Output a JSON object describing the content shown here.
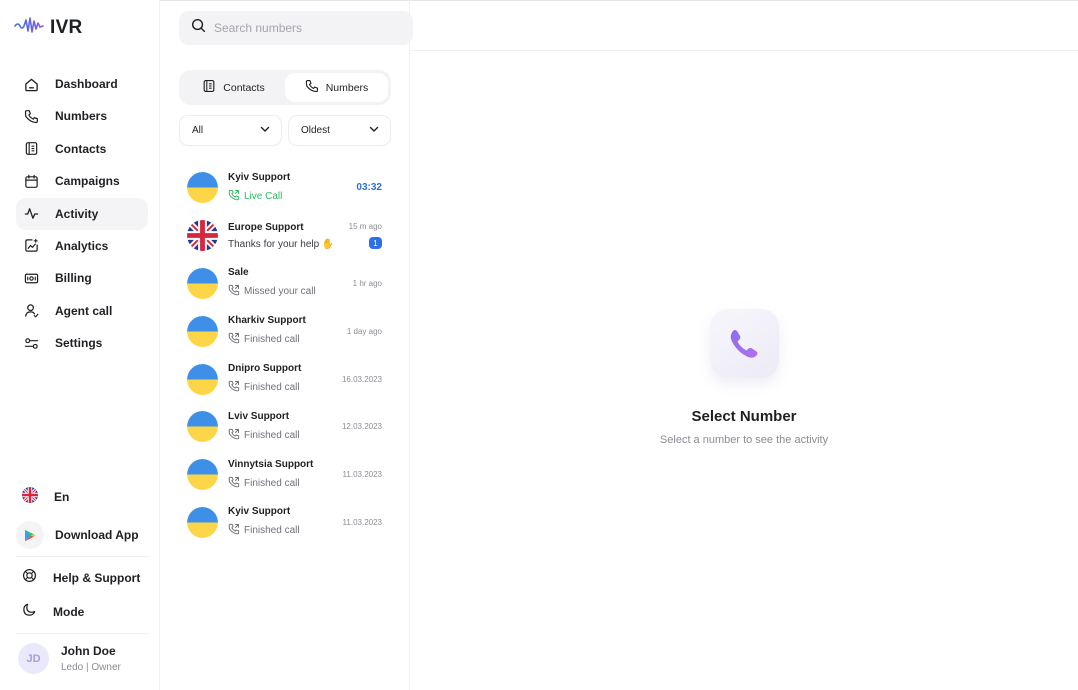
{
  "app": {
    "title": "IVR"
  },
  "colors": {
    "accent": "#2f6fe6",
    "live": "#2dbb5d",
    "brand": "#6c5ce7"
  },
  "search": {
    "placeholder": "Search numbers"
  },
  "sidebar": {
    "items": [
      {
        "label": "Dashboard",
        "icon": "home-icon"
      },
      {
        "label": "Numbers",
        "icon": "phone-icon"
      },
      {
        "label": "Contacts",
        "icon": "contacts-book-icon"
      },
      {
        "label": "Campaigns",
        "icon": "calendar-icon"
      },
      {
        "label": "Activity",
        "icon": "activity-pulse-icon",
        "active": true
      },
      {
        "label": "Analytics",
        "icon": "analytics-icon"
      },
      {
        "label": "Billing",
        "icon": "billing-icon"
      },
      {
        "label": "Agent call",
        "icon": "agent-icon"
      },
      {
        "label": "Settings",
        "icon": "settings-sliders-icon"
      }
    ],
    "language": "En",
    "download": "Download App",
    "help": "Help & Support",
    "mode": "Mode",
    "user": {
      "initials": "JD",
      "name": "John Doe",
      "role": "Ledo | Owner"
    }
  },
  "tabs": [
    {
      "label": "Contacts",
      "icon": "contacts-book-icon"
    },
    {
      "label": "Numbers",
      "icon": "phone-icon",
      "active": true
    }
  ],
  "filters": {
    "type": "All",
    "sort": "Oldest"
  },
  "calls": [
    {
      "name": "Kyiv Support",
      "status": "Live Call",
      "time": "03:32",
      "flag": "ua",
      "live": true
    },
    {
      "name": "Europe Support",
      "status": "Thanks for your help ✋",
      "time": "15 m ago",
      "flag": "uk",
      "unread": "1"
    },
    {
      "name": "Sale",
      "status": "Missed your call",
      "time": "1 hr ago",
      "flag": "ua"
    },
    {
      "name": "Kharkiv Support",
      "status": "Finished call",
      "time": "1 day ago",
      "flag": "ua"
    },
    {
      "name": "Dnipro Support",
      "status": "Finished call",
      "time": "16.03.2023",
      "flag": "ua"
    },
    {
      "name": "Lviv Support",
      "status": "Finished call",
      "time": "12.03.2023",
      "flag": "ua"
    },
    {
      "name": "Vinnytsia Support",
      "status": "Finished call",
      "time": "11.03.2023",
      "flag": "ua"
    },
    {
      "name": "Kyiv Support",
      "status": "Finished call",
      "time": "11.03.2023",
      "flag": "ua"
    }
  ],
  "empty_state": {
    "title": "Select Number",
    "subtitle": "Select a number to see the activity"
  }
}
